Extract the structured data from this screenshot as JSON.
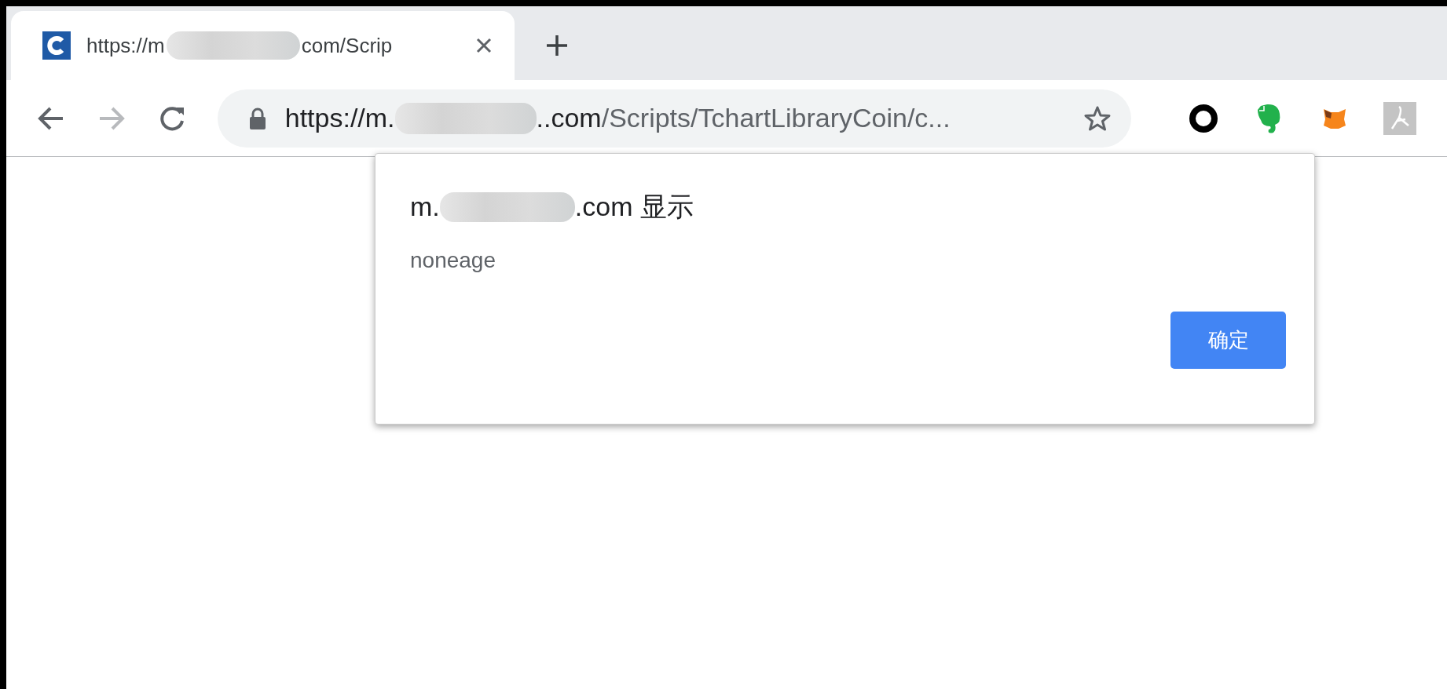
{
  "tab": {
    "title_start": "https://m",
    "title_end": "com/Scrip"
  },
  "toolbar": {
    "url_start": "https://m.",
    "url_host_end": "..com",
    "url_path": "/Scripts/TchartLibraryCoin/c..."
  },
  "dialog": {
    "title_start": "m.",
    "title_end": ".com 显示",
    "message": "noneage",
    "button": "确定"
  }
}
